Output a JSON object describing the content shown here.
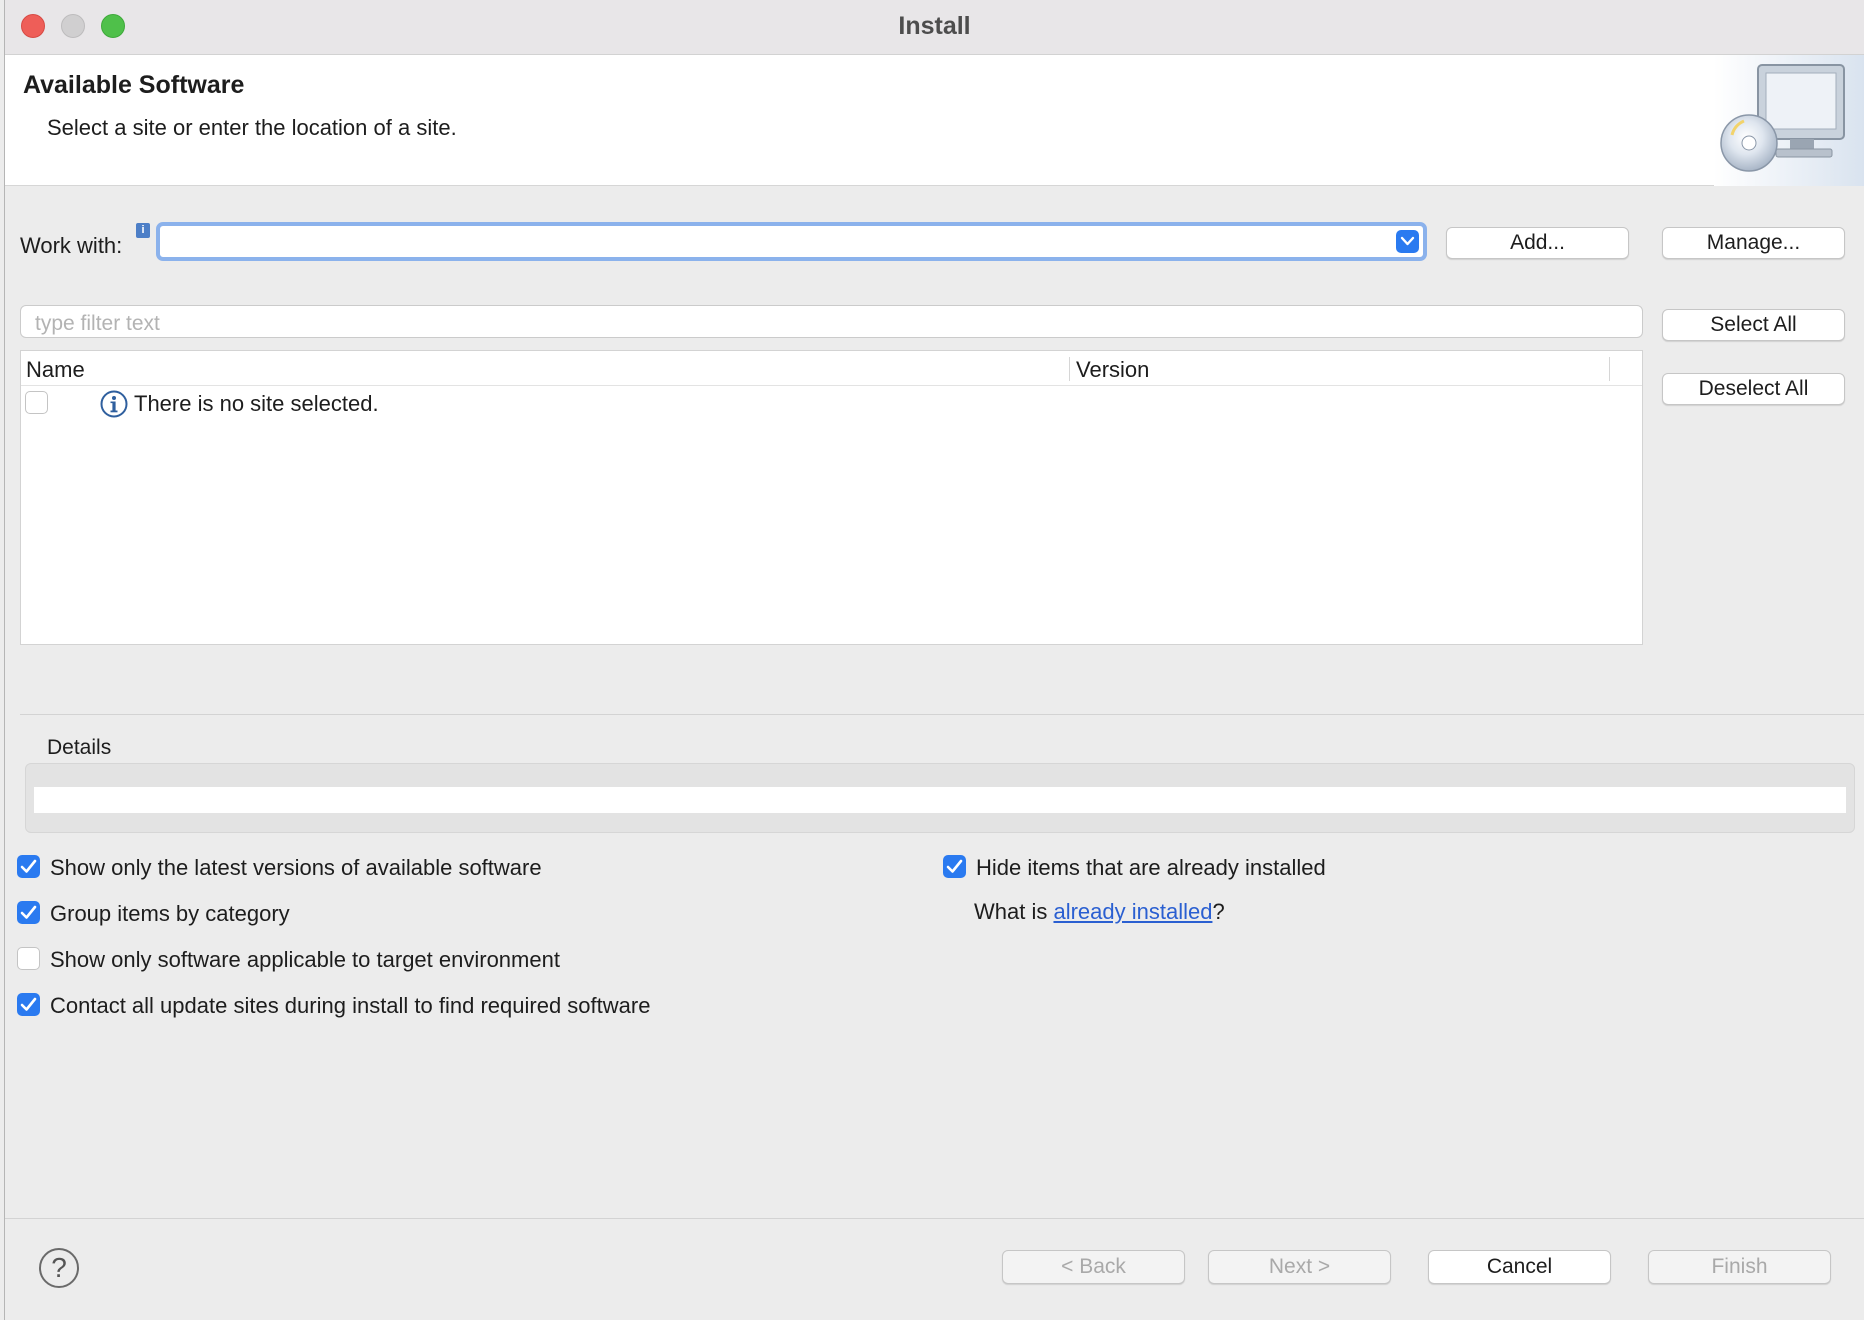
{
  "window": {
    "title": "Install"
  },
  "banner": {
    "title": "Available Software",
    "description": "Select a site or enter the location of a site."
  },
  "work_with": {
    "label": "Work with:",
    "value": "",
    "add_label": "Add...",
    "manage_label": "Manage..."
  },
  "filter": {
    "placeholder": "type filter text",
    "value": ""
  },
  "selection_buttons": {
    "select_all": "Select All",
    "deselect_all": "Deselect All"
  },
  "table": {
    "columns": [
      "Name",
      "Version"
    ],
    "rows": [
      {
        "checked": false,
        "icon": "info-icon",
        "name": "There is no site selected.",
        "version": ""
      }
    ]
  },
  "details": {
    "label": "Details",
    "value": ""
  },
  "options": {
    "latest_versions": {
      "label": "Show only the latest versions of available software",
      "checked": true
    },
    "group_by_category": {
      "label": "Group items by category",
      "checked": true
    },
    "applicable_target": {
      "label": "Show only software applicable to target environment",
      "checked": false
    },
    "contact_update_sites": {
      "label": "Contact all update sites during install to find required software",
      "checked": true
    },
    "hide_installed": {
      "label": "Hide items that are already installed",
      "checked": true
    },
    "what_is_prefix": "What is ",
    "what_is_link": "already installed",
    "what_is_suffix": "?"
  },
  "footer": {
    "back": "< Back",
    "next": "Next >",
    "cancel": "Cancel",
    "finish": "Finish"
  },
  "colors": {
    "accent": "#2a7af0",
    "link": "#2a5fd1",
    "focus_ring": "#8bb2ec"
  }
}
